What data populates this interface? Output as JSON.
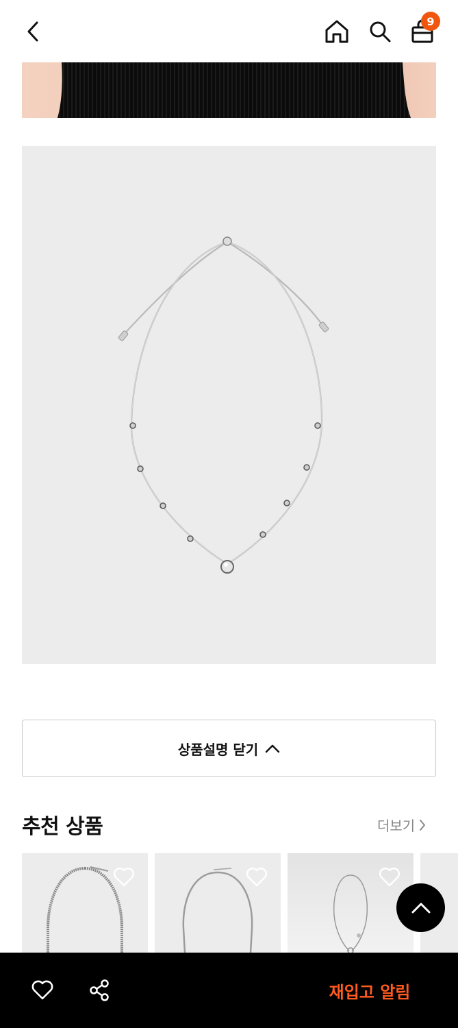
{
  "header": {
    "back_icon": "chevron-left-icon",
    "home_icon": "home-icon",
    "search_icon": "search-icon",
    "bag_icon": "shopping-bag-icon",
    "bag_count": "9",
    "badge_color": "#f0560e"
  },
  "description": {
    "close_label": "상품설명 닫기",
    "close_icon": "chevron-up-icon"
  },
  "recommended": {
    "title": "추천 상품",
    "more_label": "더보기",
    "more_icon": "chevron-right-icon",
    "items": [
      {
        "wish_icon": "heart-outline-icon"
      },
      {
        "wish_icon": "heart-outline-icon"
      },
      {
        "wish_icon": "heart-outline-icon"
      },
      {}
    ]
  },
  "scroll_top": {
    "icon": "chevron-up-icon"
  },
  "bottom_bar": {
    "wish_icon": "heart-outline-icon",
    "share_icon": "share-icon",
    "restock_label": "재입고 알림",
    "accent_color": "#ff5a1f"
  }
}
